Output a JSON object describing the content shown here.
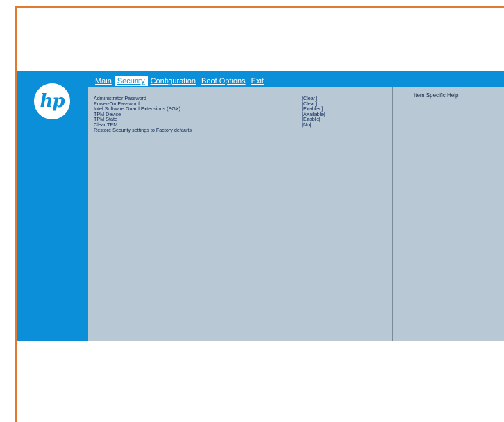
{
  "bios": {
    "logo_text": "hp",
    "menu": [
      {
        "label": "Main"
      },
      {
        "label": "Security"
      },
      {
        "label": "Configuration"
      },
      {
        "label": "Boot Options"
      },
      {
        "label": "Exit"
      }
    ],
    "settings": [
      {
        "label": "Administrator Password",
        "value": "[Clear]"
      },
      {
        "label": "Power-On Password",
        "value": "[Clear]"
      },
      {
        "label": "Intel Software Guard Extensions (SGX)",
        "value": "[Enabled]"
      },
      {
        "label": "TPM Device",
        "value": "[Available]"
      },
      {
        "label": "TPM State",
        "value": "[Enable]"
      },
      {
        "label": "Clear TPM",
        "value": "[No]"
      },
      {
        "label": "Restore Security settings to Factory defaults",
        "value": ""
      }
    ],
    "help_title": "Item Specific Help",
    "colors": {
      "accent": "#0a8fd8",
      "panel": "#b8c8d4",
      "frame": "#e07a2e"
    }
  }
}
